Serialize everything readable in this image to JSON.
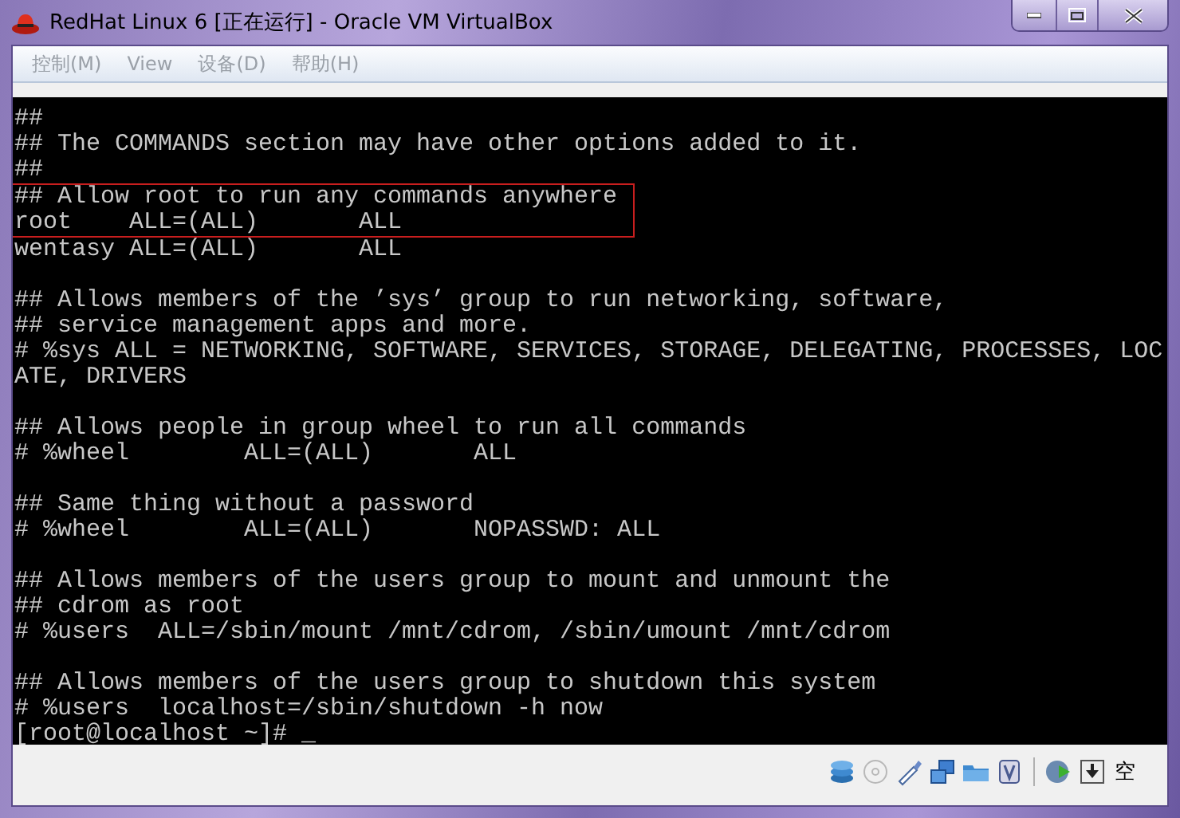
{
  "window": {
    "title": "RedHat Linux 6 [正在运行] - Oracle VM VirtualBox"
  },
  "menu": [
    "控制(M)",
    "View",
    "设备(D)",
    "帮助(H)"
  ],
  "terminal": {
    "lines": [
      {
        "kind": "text",
        "text": "##",
        "highlighted": false
      },
      {
        "kind": "text",
        "text": "## The COMMANDS section may have other options added to it.",
        "highlighted": false
      },
      {
        "kind": "text",
        "text": "##",
        "highlighted": false
      },
      {
        "kind": "text",
        "text": "## Allow root to run any commands anywhere",
        "highlighted": true
      },
      {
        "kind": "text",
        "text": "root    ALL=(ALL)       ALL",
        "highlighted": true
      },
      {
        "kind": "text",
        "text": "wentasy ALL=(ALL)       ALL",
        "highlighted": false
      },
      {
        "kind": "blank"
      },
      {
        "kind": "text",
        "text": "## Allows members of the ’sys’ group to run networking, software,",
        "highlighted": false
      },
      {
        "kind": "text",
        "text": "## service management apps and more.",
        "highlighted": false
      },
      {
        "kind": "text",
        "text": "# %sys ALL = NETWORKING, SOFTWARE, SERVICES, STORAGE, DELEGATING, PROCESSES, LOC",
        "highlighted": false
      },
      {
        "kind": "text",
        "text": "ATE, DRIVERS",
        "highlighted": false
      },
      {
        "kind": "blank"
      },
      {
        "kind": "text",
        "text": "## Allows people in group wheel to run all commands",
        "highlighted": false
      },
      {
        "kind": "text",
        "text": "# %wheel        ALL=(ALL)       ALL",
        "highlighted": false
      },
      {
        "kind": "blank"
      },
      {
        "kind": "text",
        "text": "## Same thing without a password",
        "highlighted": false
      },
      {
        "kind": "text",
        "text": "# %wheel        ALL=(ALL)       NOPASSWD: ALL",
        "highlighted": false
      },
      {
        "kind": "blank"
      },
      {
        "kind": "text",
        "text": "## Allows members of the users group to mount and unmount the",
        "highlighted": false
      },
      {
        "kind": "text",
        "text": "## cdrom as root",
        "highlighted": false
      },
      {
        "kind": "text",
        "text": "# %users  ALL=/sbin/mount /mnt/cdrom, /sbin/umount /mnt/cdrom",
        "highlighted": false
      },
      {
        "kind": "blank"
      },
      {
        "kind": "text",
        "text": "## Allows members of the users group to shutdown this system",
        "highlighted": false
      },
      {
        "kind": "text",
        "text": "# %users  localhost=/sbin/shutdown -h now",
        "highlighted": false
      },
      {
        "kind": "text",
        "text": "[root@localhost ~]# _",
        "highlighted": false
      }
    ]
  },
  "status_bar": {
    "keyboard_text": "空"
  }
}
